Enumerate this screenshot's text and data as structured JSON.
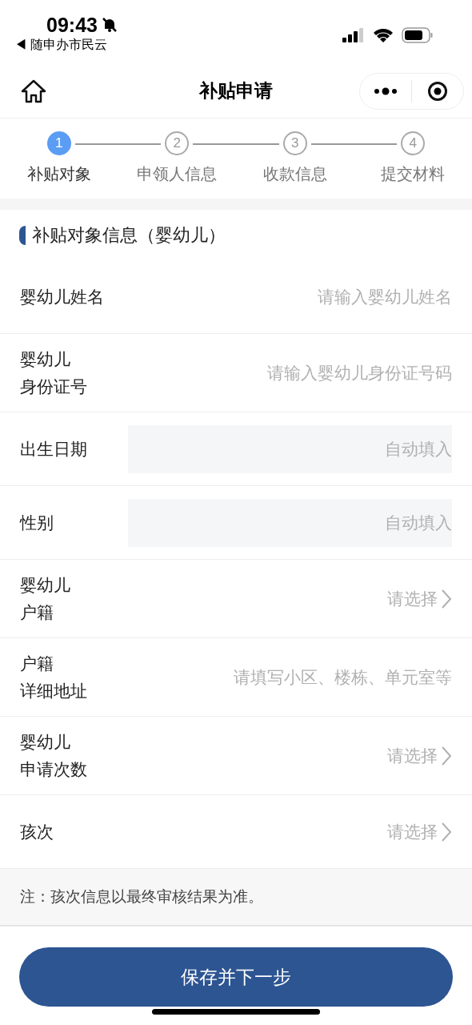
{
  "status_bar": {
    "time": "09:43",
    "back_app": "◀ 随申办市民云"
  },
  "nav": {
    "title": "补贴申请"
  },
  "steps": [
    {
      "number": "1",
      "label": "补贴对象",
      "selected": true
    },
    {
      "number": "2",
      "label": "申领人信息",
      "selected": false
    },
    {
      "number": "3",
      "label": "收款信息",
      "selected": false
    },
    {
      "number": "4",
      "label": "提交材料",
      "selected": false
    }
  ],
  "section": {
    "title": "补贴对象信息（婴幼儿）"
  },
  "fields": [
    {
      "kind": "input",
      "label": [
        "婴幼儿姓名"
      ],
      "placeholder": "请输入婴幼儿姓名"
    },
    {
      "kind": "input",
      "label": [
        "婴幼儿",
        "身份证号"
      ],
      "placeholder": "请输入婴幼儿身份证号码"
    },
    {
      "kind": "auto",
      "label": [
        "出生日期"
      ],
      "placeholder": "自动填入"
    },
    {
      "kind": "auto",
      "label": [
        "性别"
      ],
      "placeholder": "自动填入"
    },
    {
      "kind": "select",
      "label": [
        "婴幼儿",
        "户籍"
      ],
      "placeholder": "请选择"
    },
    {
      "kind": "input",
      "label": [
        "户籍",
        "详细地址"
      ],
      "placeholder": "请填写小区、楼栋、单元室等"
    },
    {
      "kind": "select",
      "label": [
        "婴幼儿",
        "申请次数"
      ],
      "placeholder": "请选择"
    },
    {
      "kind": "select",
      "label": [
        "孩次"
      ],
      "placeholder": "请选择"
    }
  ],
  "note": "注：孩次信息以最终审核结果为准。",
  "submit_button": "保存并下一步"
}
